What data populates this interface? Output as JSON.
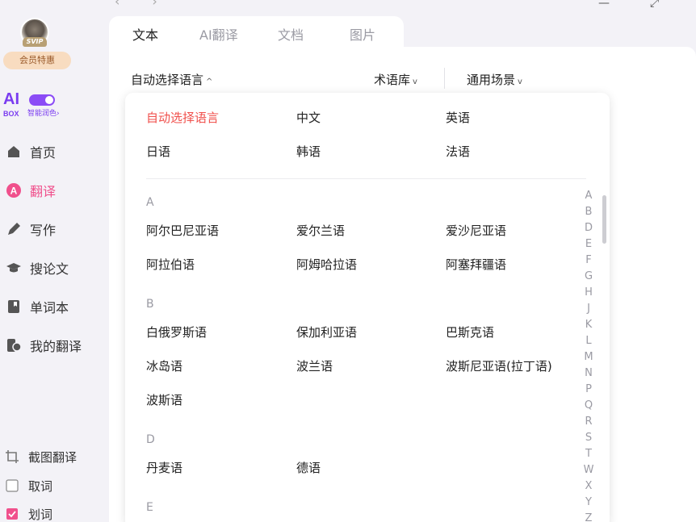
{
  "sidebar": {
    "badge": "SVIP",
    "member_label": "会员特惠",
    "aibox_ai": "AI",
    "aibox_box": "BOX",
    "aibox_sub": "智能润色›",
    "nav": [
      {
        "label": "首页",
        "icon": "home-icon"
      },
      {
        "label": "翻译",
        "icon": "translate-icon",
        "active": true
      },
      {
        "label": "写作",
        "icon": "pen-icon"
      },
      {
        "label": "搜论文",
        "icon": "graduation-cap-icon"
      },
      {
        "label": "单词本",
        "icon": "bookmark-icon"
      },
      {
        "label": "我的翻译",
        "icon": "my-translation-icon"
      }
    ],
    "tools": [
      {
        "label": "截图翻译",
        "icon": "crop-icon"
      },
      {
        "label": "取词",
        "icon": "checkbox-unchecked-icon",
        "checked": false
      },
      {
        "label": "划词",
        "icon": "checkbox-checked-icon",
        "checked": true
      }
    ]
  },
  "tabs": [
    "文本",
    "AI翻译",
    "文档",
    "图片"
  ],
  "active_tab": "文本",
  "lang_bar": {
    "source_lang": "自动选择语言",
    "term_label": "术语库",
    "scene_label": "通用场景"
  },
  "dropdown": {
    "common": [
      "自动选择语言",
      "中文",
      "英语",
      "日语",
      "韩语",
      "法语"
    ],
    "selected": "自动选择语言",
    "groups": [
      {
        "letter": "A",
        "items": [
          "阿尔巴尼亚语",
          "爱尔兰语",
          "爱沙尼亚语",
          "阿拉伯语",
          "阿姆哈拉语",
          "阿塞拜疆语"
        ]
      },
      {
        "letter": "B",
        "items": [
          "白俄罗斯语",
          "保加利亚语",
          "巴斯克语",
          "冰岛语",
          "波兰语",
          "波斯尼亚语(拉丁语)",
          "波斯语"
        ]
      },
      {
        "letter": "D",
        "items": [
          "丹麦语",
          "德语"
        ]
      },
      {
        "letter": "E",
        "items": []
      }
    ],
    "az_index": [
      "A",
      "B",
      "D",
      "E",
      "F",
      "G",
      "H",
      "J",
      "K",
      "L",
      "M",
      "N",
      "P",
      "Q",
      "R",
      "S",
      "T",
      "W",
      "X",
      "Y",
      "Z"
    ]
  },
  "colors": {
    "accent_pink": "#f0508c",
    "selected_red": "#f0504c",
    "ai_purple": "#7a3cf0"
  }
}
